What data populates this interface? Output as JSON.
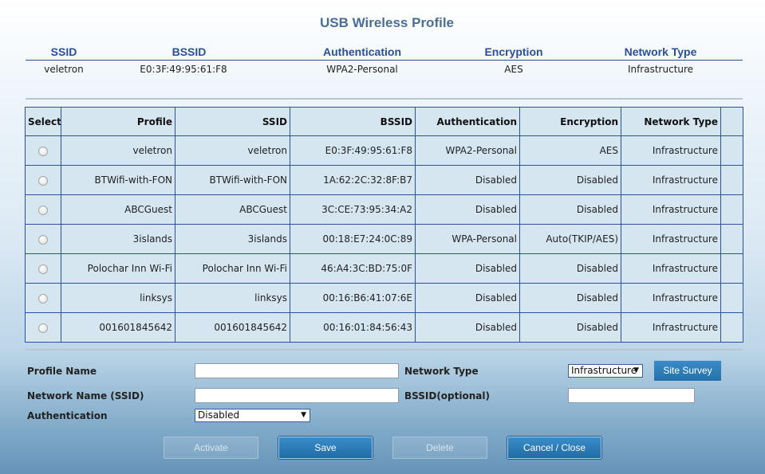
{
  "title": "USB Wireless Profile",
  "current": {
    "headers": [
      "SSID",
      "BSSID",
      "Authentication",
      "Encryption",
      "Network Type"
    ],
    "values": [
      "veletron",
      "E0:3F:49:95:61:F8",
      "WPA2-Personal",
      "AES",
      "Infrastructure"
    ]
  },
  "profiles": {
    "headers": [
      "Select",
      "Profile",
      "SSID",
      "BSSID",
      "Authentication",
      "Encryption",
      "Network Type"
    ],
    "rows": [
      [
        "veletron",
        "veletron",
        "E0:3F:49:95:61:F8",
        "WPA2-Personal",
        "AES",
        "Infrastructure"
      ],
      [
        "BTWifi-with-FON",
        "BTWifi-with-FON",
        "1A:62:2C:32:8F:B7",
        "Disabled",
        "Disabled",
        "Infrastructure"
      ],
      [
        "ABCGuest",
        "ABCGuest",
        "3C:CE:73:95:34:A2",
        "Disabled",
        "Disabled",
        "Infrastructure"
      ],
      [
        "3islands",
        "3islands",
        "00:18:E7:24:0C:89",
        "WPA-Personal",
        "Auto(TKIP/AES)",
        "Infrastructure"
      ],
      [
        "Polochar Inn Wi-Fi",
        "Polochar Inn Wi-Fi",
        "46:A4:3C:BD:75:0F",
        "Disabled",
        "Disabled",
        "Infrastructure"
      ],
      [
        "linksys",
        "linksys",
        "00:16:B6:41:07:6E",
        "Disabled",
        "Disabled",
        "Infrastructure"
      ],
      [
        "001601845642",
        "001601845642",
        "00:16:01:84:56:43",
        "Disabled",
        "Disabled",
        "Infrastructure"
      ]
    ]
  },
  "form": {
    "profile_name_label": "Profile Name",
    "profile_name_value": "",
    "network_name_label": "Network Name (SSID)",
    "network_name_value": "",
    "authentication_label": "Authentication",
    "authentication_value": "Disabled",
    "network_type_label": "Network Type",
    "network_type_value": "Infrastructure",
    "bssid_label": "BSSID(optional)",
    "bssid_value": "",
    "site_survey_label": "Site Survey"
  },
  "buttons": {
    "activate": "Activate",
    "save": "Save",
    "delete": "Delete",
    "cancel": "Cancel / Close"
  }
}
